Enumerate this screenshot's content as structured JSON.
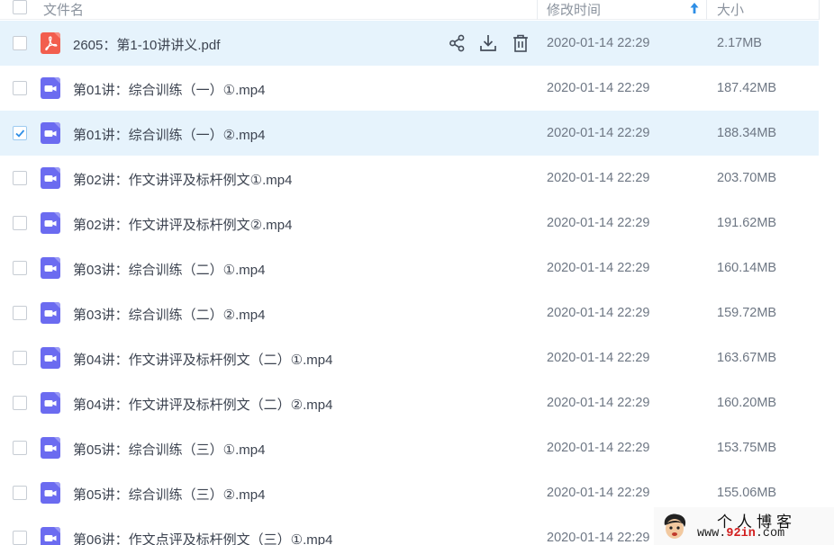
{
  "header": {
    "name_label": "文件名",
    "time_label": "修改时间",
    "size_label": "大小"
  },
  "colors": {
    "row_highlight": "#e6f3fc",
    "pdf_icon": "#f25e4e",
    "video_icon": "#6b6bf0",
    "check": "#2e8ee6",
    "sort_arrow": "#2e8ee6"
  },
  "rows": [
    {
      "name": "2605：第1-10讲讲义.pdf",
      "time": "2020-01-14 22:29",
      "size": "2.17MB",
      "type": "pdf-icon",
      "checked": false,
      "hovered": true
    },
    {
      "name": "第01讲：综合训练（一）①.mp4",
      "time": "2020-01-14 22:29",
      "size": "187.42MB",
      "type": "video-icon",
      "checked": false
    },
    {
      "name": "第01讲：综合训练（一）②.mp4",
      "time": "2020-01-14 22:29",
      "size": "188.34MB",
      "type": "video-icon",
      "checked": true
    },
    {
      "name": "第02讲：作文讲评及标杆例文①.mp4",
      "time": "2020-01-14 22:29",
      "size": "203.70MB",
      "type": "video-icon",
      "checked": false
    },
    {
      "name": "第02讲：作文讲评及标杆例文②.mp4",
      "time": "2020-01-14 22:29",
      "size": "191.62MB",
      "type": "video-icon",
      "checked": false
    },
    {
      "name": "第03讲：综合训练（二）①.mp4",
      "time": "2020-01-14 22:29",
      "size": "160.14MB",
      "type": "video-icon",
      "checked": false
    },
    {
      "name": "第03讲：综合训练（二）②.mp4",
      "time": "2020-01-14 22:29",
      "size": "159.72MB",
      "type": "video-icon",
      "checked": false
    },
    {
      "name": "第04讲：作文讲评及标杆例文（二）①.mp4",
      "time": "2020-01-14 22:29",
      "size": "163.67MB",
      "type": "video-icon",
      "checked": false
    },
    {
      "name": "第04讲：作文讲评及标杆例文（二）②.mp4",
      "time": "2020-01-14 22:29",
      "size": "160.20MB",
      "type": "video-icon",
      "checked": false
    },
    {
      "name": "第05讲：综合训练（三）①.mp4",
      "time": "2020-01-14 22:29",
      "size": "153.75MB",
      "type": "video-icon",
      "checked": false
    },
    {
      "name": "第05讲：综合训练（三）②.mp4",
      "time": "2020-01-14 22:29",
      "size": "155.06MB",
      "type": "video-icon",
      "checked": false
    },
    {
      "name": "第06讲：作文点评及标杆例文（三）①.mp4",
      "time": "2020-01-14 22:29",
      "size": "",
      "type": "video-icon",
      "checked": false
    }
  ],
  "row_actions": [
    "share-icon",
    "download-icon",
    "delete-icon"
  ],
  "watermark": {
    "title": "个人博客",
    "url_prefix": "www.",
    "url_highlight": "92in",
    "url_suffix": ".com"
  }
}
